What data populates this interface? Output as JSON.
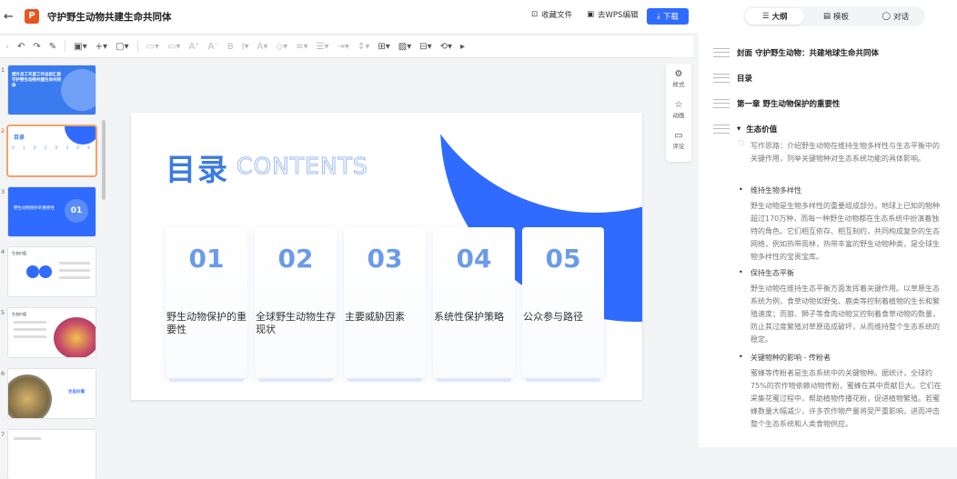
{
  "header": {
    "title": "守护野生动物共建生命共同体",
    "logo_letter": "P",
    "collect": "收藏文件",
    "wps": "去WPS编辑",
    "download": "下载"
  },
  "thumbs": [
    {
      "n": "1",
      "text": "提升员工年度工作总结汇报守护野生动物共建生命共同体"
    },
    {
      "n": "2",
      "text": "目录"
    },
    {
      "n": "3",
      "text": "野生动物保护的重要性",
      "big": "01"
    },
    {
      "n": "4",
      "text": "生态价值"
    },
    {
      "n": "5",
      "text": "生态价值"
    },
    {
      "n": "6",
      "text": "生态价值"
    },
    {
      "n": "7",
      "text": ""
    }
  ],
  "slide": {
    "title": "目录",
    "subtitle": "CONTENTS",
    "cards": [
      {
        "num": "01",
        "label": "野生动物保护的重要性"
      },
      {
        "num": "02",
        "label": "全球野生动物生存现状"
      },
      {
        "num": "03",
        "label": "主要威胁因素"
      },
      {
        "num": "04",
        "label": "系统性保护策略"
      },
      {
        "num": "05",
        "label": "公众参与路径"
      }
    ]
  },
  "right_tools": {
    "style": "样式",
    "anim": "动画",
    "comment": "评论"
  },
  "panel": {
    "tabs": [
      "大纲",
      "模板",
      "对话"
    ],
    "outline": [
      {
        "t": "封面 守护野生动物：共建地球生命共同体"
      },
      {
        "t": "目录"
      },
      {
        "t": "第一章 野生动物保护的重要性"
      },
      {
        "t": "生态价值"
      }
    ],
    "idea": "写作思路：介绍野生动物在维持生物多样性与生态平衡中的关键作用，列举关键物种对生态系统功能的具体影响。",
    "b1": "维持生物多样性",
    "p1": "野生动物是生物多样性的重要组成部分。地球上已知的物种超过170万种，而每一种野生动物都在生态系统中扮演着独特的角色。它们相互依存、相互制约，共同构成复杂的生态网络，例如热带雨林，热带丰富的野生动物种类，是全球生物多样性的宝贵宝库。",
    "b2": "保持生态平衡",
    "p2": "野生动物在维持生态平衡方面发挥着关键作用。以草原生态系统为例，食草动物如野兔、鹿类等控制着植物的生长和繁殖速度；而狼、狮子等食肉动物又控制着食草动物的数量，防止其过度繁殖对草原造成破坏，从而维持整个生态系统的稳定。",
    "b3": "关键物种的影响 - 传粉者",
    "p3": "蜜蜂等传粉者是生态系统中的关键物种。据统计，全球约75%的农作物依赖动物传粉，蜜蜂在其中贡献巨大。它们在采集花蜜过程中，帮助植物传播花粉，促进植物繁殖。若蜜蜂数量大幅减少，许多农作物产量将受严重影响，进而冲击整个生态系统和人类食物供应。"
  }
}
